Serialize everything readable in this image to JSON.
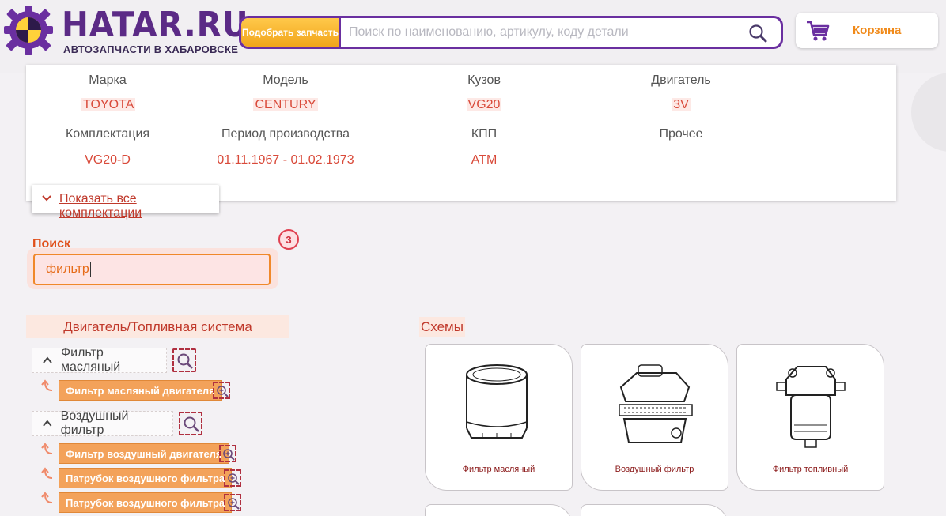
{
  "header": {
    "brand": "HATAR.RU",
    "brand_sub": "АВТОЗАПЧАСТИ В ХАБАРОВСКЕ",
    "pick_part_label": "Подобрать запчасть",
    "search_placeholder": "Поиск по наименованию, артикулу, коду детали",
    "cart_label": "Корзина"
  },
  "vehicle": {
    "labels": {
      "make": "Марка",
      "model": "Модель",
      "body": "Кузов",
      "engine": "Двигатель",
      "trim": "Комплектация",
      "period": "Период производства",
      "transmission": "КПП",
      "other": "Прочее"
    },
    "values": {
      "make": "TOYOTA",
      "model": "CENTURY",
      "body": "VG20",
      "engine": "3V",
      "trim": "VG20-D",
      "period": "01.11.1967 - 01.02.1973",
      "transmission": "ATM"
    },
    "show_all_label": "Показать все комплектации"
  },
  "filter": {
    "label": "Поиск",
    "value": "фильтр",
    "count": "3"
  },
  "tree": {
    "section_title": "Двигатель/Топливная система",
    "categories": [
      {
        "name": "Фильтр масляный",
        "items": [
          "Фильтр масляный двигателя"
        ]
      },
      {
        "name": "Воздушный фильтр",
        "items": [
          "Фильтр воздушный двигателя",
          "Патрубок воздушного фильтра",
          "Патрубок воздушного фильтра"
        ]
      }
    ]
  },
  "schemes": {
    "title": "Схемы",
    "cards": [
      {
        "caption": "Фильтр масляный"
      },
      {
        "caption": "Воздушный фильтр"
      },
      {
        "caption": "Фильтр топливный"
      }
    ]
  },
  "colors": {
    "brand_purple": "#5b2a86",
    "accent_orange": "#f3a25a",
    "value_red": "#d94a3a"
  }
}
